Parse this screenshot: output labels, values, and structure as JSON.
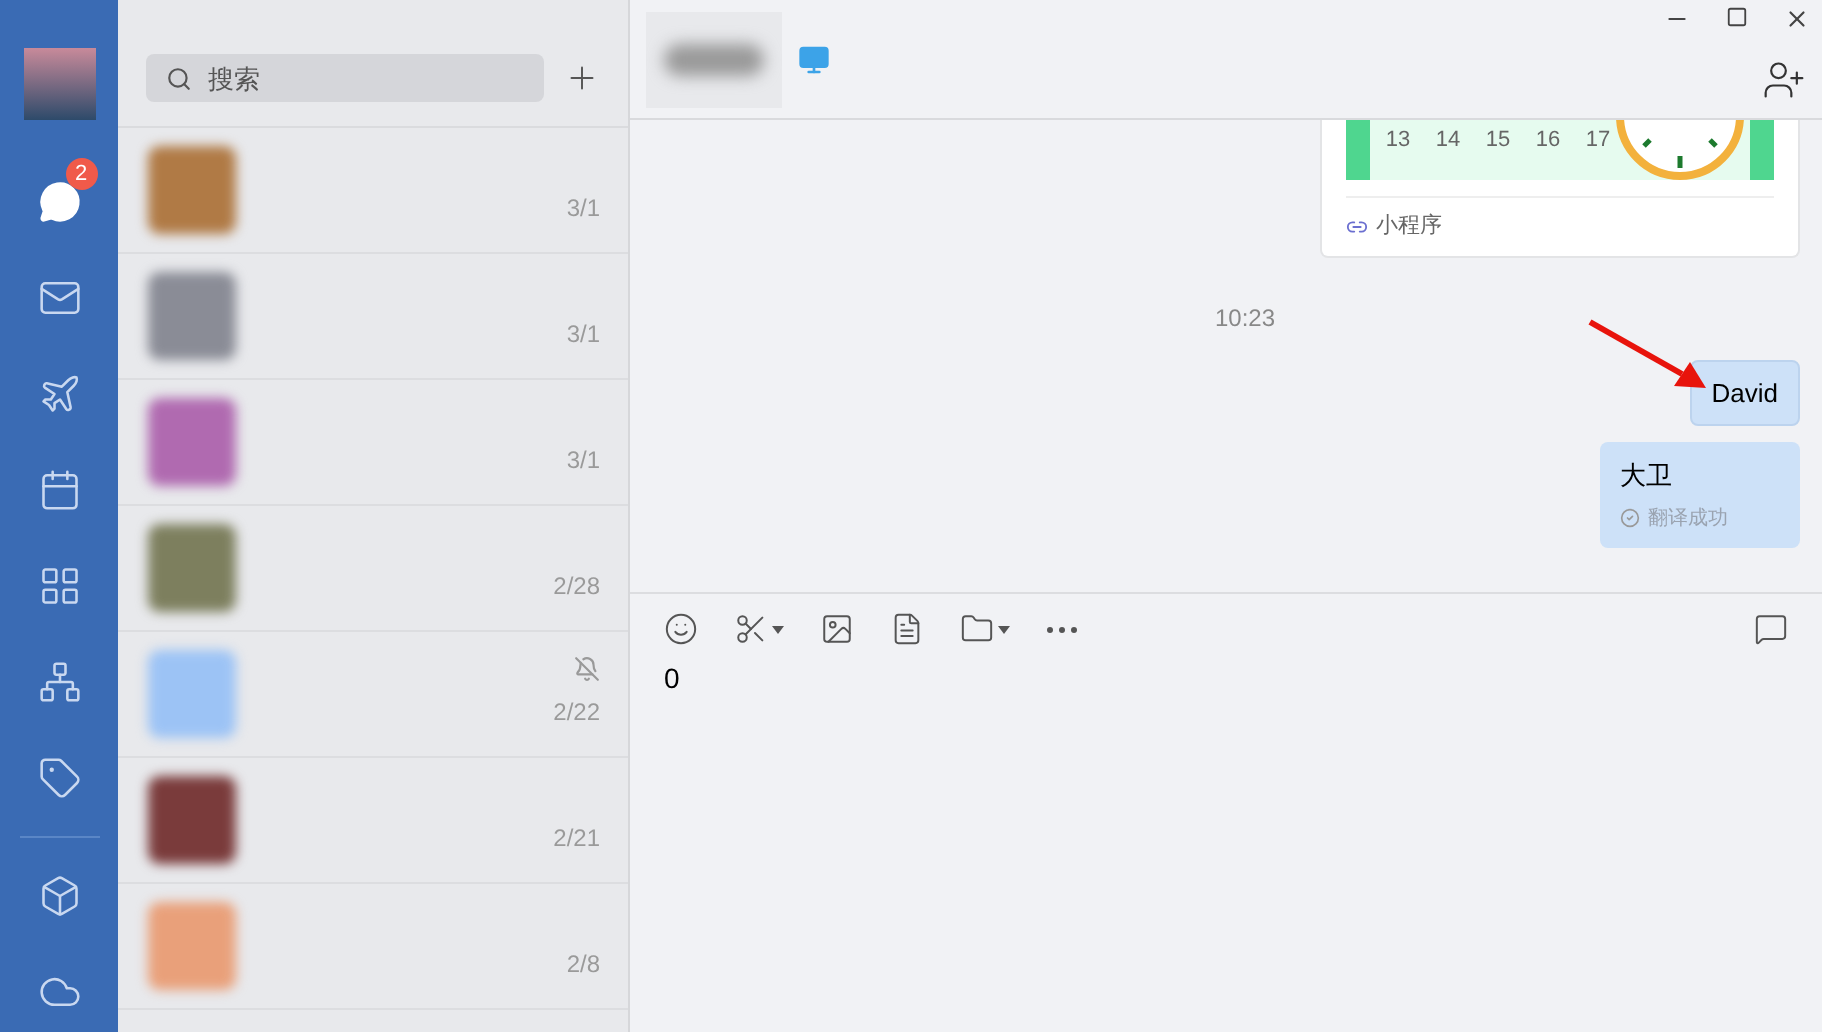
{
  "sidebar": {
    "items": [
      {
        "kind": "chat",
        "badge": "2",
        "selected": true
      },
      {
        "kind": "mail",
        "selected": false
      },
      {
        "kind": "workbench",
        "selected": false
      },
      {
        "kind": "calendar",
        "selected": false
      },
      {
        "kind": "apps",
        "selected": false
      },
      {
        "kind": "contacts",
        "selected": false
      },
      {
        "kind": "tag",
        "selected": false
      },
      {
        "kind": "docs",
        "selected": false
      },
      {
        "kind": "cloud",
        "selected": false
      }
    ]
  },
  "search": {
    "placeholder": "搜索"
  },
  "chats": [
    {
      "date": "3/1",
      "color": "#b07a45",
      "muted": false
    },
    {
      "date": "3/1",
      "color": "#8a8c96",
      "muted": false
    },
    {
      "date": "3/1",
      "color": "#b06ab0",
      "muted": false
    },
    {
      "date": "2/28",
      "color": "#7d7f5e",
      "muted": false
    },
    {
      "date": "2/22",
      "color": "#9cc3f5",
      "muted": true
    },
    {
      "date": "2/21",
      "color": "#7a3b3b",
      "muted": false
    },
    {
      "date": "2/8",
      "color": "#e9a07a",
      "muted": false
    }
  ],
  "conversation": {
    "messages": [
      {
        "kind": "miniprogram",
        "calendar_days": [
          "13",
          "14",
          "15",
          "16",
          "17"
        ],
        "label": "小程序"
      },
      {
        "kind": "time",
        "text": "10:23"
      },
      {
        "kind": "text",
        "text": "David",
        "annotated": true
      },
      {
        "kind": "translation",
        "text": "大卫",
        "status": "翻译成功"
      }
    ],
    "input": {
      "value": "0"
    }
  }
}
